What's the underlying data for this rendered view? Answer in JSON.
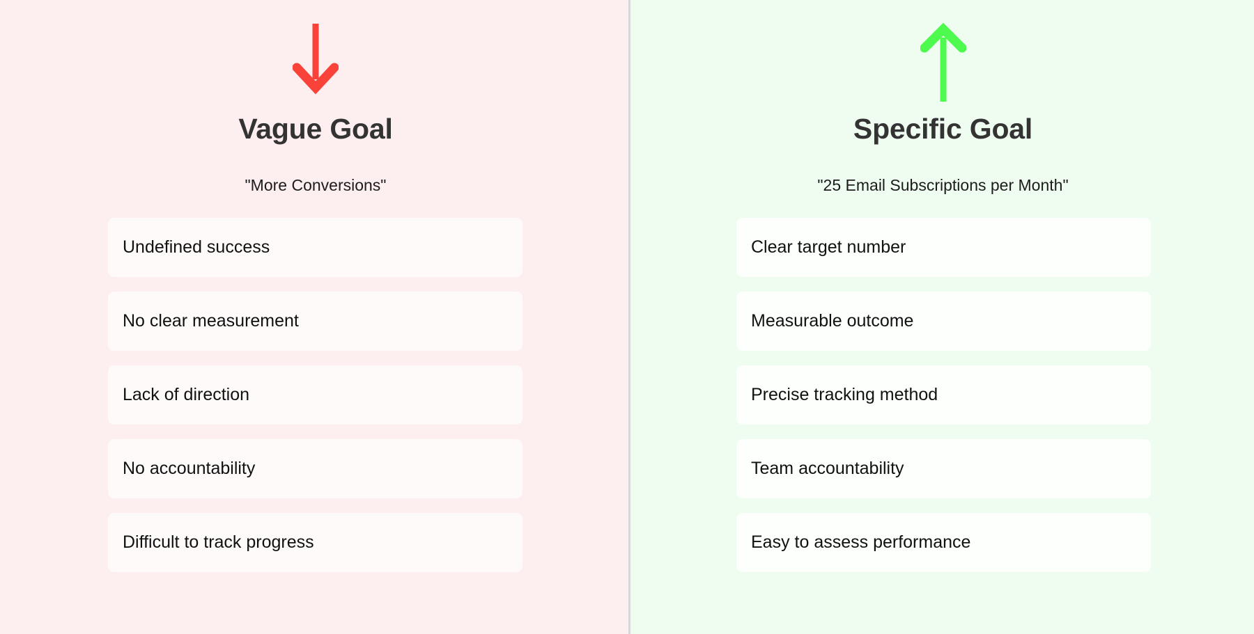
{
  "layout": {
    "divider_color": "#d8d8d8"
  },
  "panels": [
    {
      "id": "vague",
      "arrow": {
        "icon": "arrow-down-icon",
        "direction": "down",
        "color": "#f9423a"
      },
      "background_color": "#fdeef0",
      "card_color": "#fffafa",
      "title": "Vague Goal",
      "subtitle": "\"More Conversions\"",
      "items": [
        "Undefined success",
        "No clear measurement",
        "Lack of direction",
        "No accountability",
        "Difficult to track progress"
      ]
    },
    {
      "id": "specific",
      "arrow": {
        "icon": "arrow-up-icon",
        "direction": "up",
        "color": "#4dfa4d"
      },
      "background_color": "#effdf0",
      "card_color": "#fcfffc",
      "title": "Specific Goal",
      "subtitle": "\"25 Email Subscriptions per Month\"",
      "items": [
        "Clear target number",
        "Measurable outcome",
        "Precise tracking method",
        "Team accountability",
        "Easy to assess performance"
      ]
    }
  ]
}
